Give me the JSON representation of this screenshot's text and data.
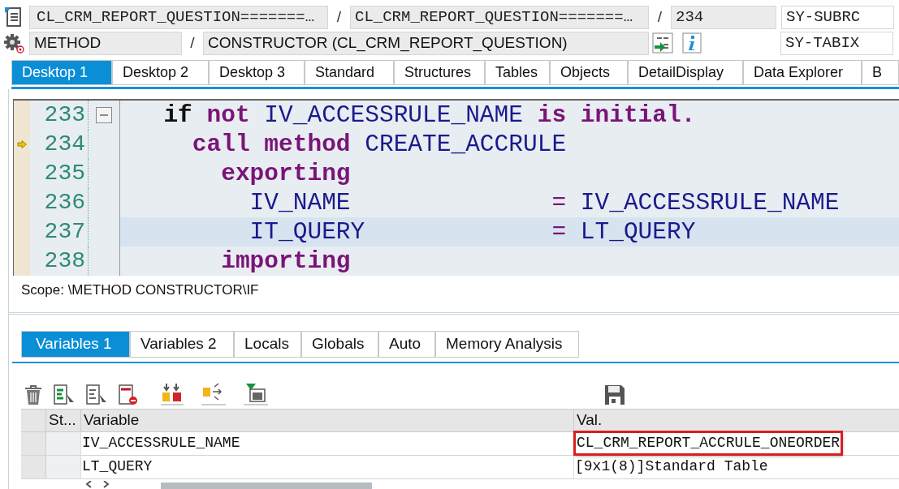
{
  "header": {
    "program": "CL_CRM_REPORT_QUESTION=======…",
    "separator_1": "/",
    "include": "CL_CRM_REPORT_QUESTION=======…",
    "separator_2": "/",
    "line": "234",
    "sysvar_1": "SY-SUBRC",
    "event_type": "METHOD",
    "separator_3": "/",
    "event": "CONSTRUCTOR (CL_CRM_REPORT_QUESTION)",
    "sysvar_2": "SY-TABIX"
  },
  "tabs": [
    {
      "label": "Desktop 1",
      "selected": true
    },
    {
      "label": "Desktop 2",
      "selected": false
    },
    {
      "label": "Desktop 3",
      "selected": false
    },
    {
      "label": "Standard",
      "selected": false
    },
    {
      "label": "Structures",
      "selected": false
    },
    {
      "label": "Tables",
      "selected": false
    },
    {
      "label": "Objects",
      "selected": false
    },
    {
      "label": "DetailDisplay",
      "selected": false
    },
    {
      "label": "Data Explorer",
      "selected": false
    },
    {
      "label": "B",
      "selected": false
    }
  ],
  "code": {
    "lines": [
      {
        "number": "233",
        "foldable": true,
        "current": false,
        "highlighted": false,
        "tokens": [
          {
            "text": "  if",
            "kind": "control"
          },
          {
            "text": " not",
            "kind": "keyword"
          },
          {
            "text": " IV_ACCESSRULE_NAME",
            "kind": "ident"
          },
          {
            "text": " is initial.",
            "kind": "keyword"
          }
        ]
      },
      {
        "number": "234",
        "foldable": false,
        "current": true,
        "highlighted": false,
        "tokens": [
          {
            "text": "    call method",
            "kind": "keyword"
          },
          {
            "text": " CREATE_ACCRULE",
            "kind": "ident"
          }
        ]
      },
      {
        "number": "235",
        "foldable": false,
        "current": false,
        "highlighted": false,
        "tokens": [
          {
            "text": "      exporting",
            "kind": "keyword"
          }
        ]
      },
      {
        "number": "236",
        "foldable": false,
        "current": false,
        "highlighted": false,
        "tokens": [
          {
            "text": "        IV_NAME",
            "kind": "ident"
          },
          {
            "text": "              =",
            "kind": "operator"
          },
          {
            "text": " IV_ACCESSRULE_NAME",
            "kind": "ident"
          }
        ]
      },
      {
        "number": "237",
        "foldable": false,
        "current": false,
        "highlighted": true,
        "tokens": [
          {
            "text": "        IT_QUERY",
            "kind": "ident"
          },
          {
            "text": "             =",
            "kind": "operator"
          },
          {
            "text": " LT_QUERY",
            "kind": "ident"
          }
        ]
      },
      {
        "number": "238",
        "foldable": false,
        "current": false,
        "highlighted": false,
        "tokens": [
          {
            "text": "      importing",
            "kind": "keyword"
          }
        ]
      }
    ]
  },
  "scope": "Scope: \\METHOD CONSTRUCTOR\\IF",
  "variable_tabs": [
    {
      "label": "Variables 1",
      "selected": true
    },
    {
      "label": "Variables 2",
      "selected": false
    },
    {
      "label": "Locals",
      "selected": false
    },
    {
      "label": "Globals",
      "selected": false
    },
    {
      "label": "Auto",
      "selected": false
    },
    {
      "label": "Memory Analysis",
      "selected": false
    }
  ],
  "table": {
    "columns": [
      "St...",
      "Variable",
      "Val."
    ],
    "rows": [
      {
        "variable": "IV_ACCESSRULE_NAME",
        "value": "CL_CRM_REPORT_ACCRULE_ONEORDER",
        "marked": true
      },
      {
        "variable": "LT_QUERY",
        "value": "[9x1(8)]Standard Table",
        "marked": false
      }
    ]
  }
}
